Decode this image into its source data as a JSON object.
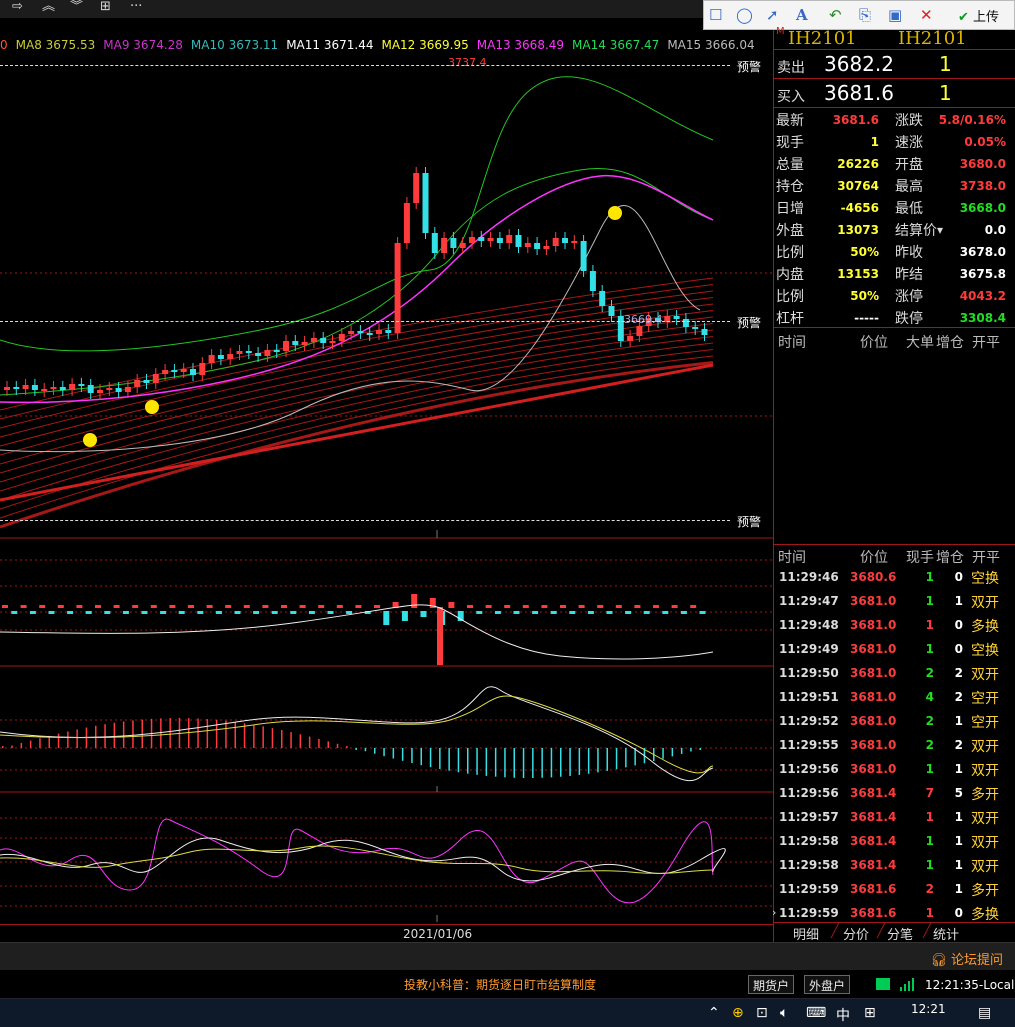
{
  "toolbar": {
    "icons": [
      "redo-icon",
      "double-up-icon",
      "double-down-icon",
      "grid-icon",
      "more-icon"
    ]
  },
  "annotation_tools": {
    "upload_label": "上传"
  },
  "ma_legend": [
    {
      "label": "0",
      "color": "#ff5533"
    },
    {
      "label": "MA8 3675.53",
      "color": "#cccc33"
    },
    {
      "label": "MA9 3674.28",
      "color": "#cc33cc"
    },
    {
      "label": "MA10 3673.11",
      "color": "#33bbbb"
    },
    {
      "label": "MA11 3671.44",
      "color": "#ffffff"
    },
    {
      "label": "MA12 3669.95",
      "color": "#ffff33"
    },
    {
      "label": "MA13 3668.49",
      "color": "#ff33ff"
    },
    {
      "label": "MA14 3667.47",
      "color": "#22dd55"
    },
    {
      "label": "MA15 3666.04",
      "color": "#bbbbbb"
    }
  ],
  "price_annotations": {
    "high": "3737.4",
    "low": "3669.4",
    "alert": "预警"
  },
  "axis": {
    "date": "2021/01/06"
  },
  "contract": {
    "name_left": "IH2101",
    "name_right": "IH2101",
    "marker": "M"
  },
  "order_book": {
    "ask_label": "卖出",
    "ask_price": "3682.2",
    "ask_vol": "1",
    "bid_label": "买入",
    "bid_price": "3681.6",
    "bid_vol": "1"
  },
  "quote": [
    {
      "l": "最新",
      "lv": "3681.6",
      "lc": "#ff3b3b",
      "r": "涨跌",
      "rv": "5.8/0.16%",
      "rc": "#ff3b3b"
    },
    {
      "l": "现手",
      "lv": "1",
      "lc": "#ffff33",
      "r": "速涨",
      "rv": "0.05%",
      "rc": "#ff3b3b"
    },
    {
      "l": "总量",
      "lv": "26226",
      "lc": "#ffff33",
      "r": "开盘",
      "rv": "3680.0",
      "rc": "#ff3b3b"
    },
    {
      "l": "持仓",
      "lv": "30764",
      "lc": "#ffff33",
      "r": "最高",
      "rv": "3738.0",
      "rc": "#ff3b3b"
    },
    {
      "l": "日增",
      "lv": "-4656",
      "lc": "#ffff33",
      "r": "最低",
      "rv": "3668.0",
      "rc": "#22dd22"
    },
    {
      "l": "外盘",
      "lv": "13073",
      "lc": "#ffff33",
      "r": "结算价",
      "rv": "0.0",
      "rc": "#ffffff"
    },
    {
      "l": "比例",
      "lv": "50%",
      "lc": "#ffff33",
      "r": "昨收",
      "rv": "3678.0",
      "rc": "#ffffff"
    },
    {
      "l": "内盘",
      "lv": "13153",
      "lc": "#ffff33",
      "r": "昨结",
      "rv": "3675.8",
      "rc": "#ffffff"
    },
    {
      "l": "比例",
      "lv": "50%",
      "lc": "#ffff33",
      "r": "涨停",
      "rv": "4043.2",
      "rc": "#ff3b3b"
    },
    {
      "l": "杠杆",
      "lv": "-----",
      "lc": "#ffffff",
      "r": "跌停",
      "rv": "3308.4",
      "rc": "#22dd22"
    }
  ],
  "big_order_header": [
    "时间",
    "价位",
    "大单",
    "增仓",
    "开平"
  ],
  "tick_header": [
    "时间",
    "价位",
    "现手",
    "增仓",
    "开平"
  ],
  "ticks": [
    {
      "t": "11:29:46",
      "p": "3680.6",
      "v": "1",
      "vc": "#22dd22",
      "c": "0",
      "k": "空换"
    },
    {
      "t": "11:29:47",
      "p": "3681.0",
      "v": "1",
      "vc": "#22dd22",
      "c": "1",
      "k": "双开"
    },
    {
      "t": "11:29:48",
      "p": "3681.0",
      "v": "1",
      "vc": "#ff3b3b",
      "c": "0",
      "k": "多换"
    },
    {
      "t": "11:29:49",
      "p": "3681.0",
      "v": "1",
      "vc": "#22dd22",
      "c": "0",
      "k": "空换"
    },
    {
      "t": "11:29:50",
      "p": "3681.0",
      "v": "2",
      "vc": "#22dd22",
      "c": "2",
      "k": "双开"
    },
    {
      "t": "11:29:51",
      "p": "3681.0",
      "v": "4",
      "vc": "#22dd22",
      "c": "2",
      "k": "空开"
    },
    {
      "t": "11:29:52",
      "p": "3681.0",
      "v": "2",
      "vc": "#22dd22",
      "c": "1",
      "k": "空开"
    },
    {
      "t": "11:29:55",
      "p": "3681.0",
      "v": "2",
      "vc": "#22dd22",
      "c": "2",
      "k": "双开"
    },
    {
      "t": "11:29:56",
      "p": "3681.0",
      "v": "1",
      "vc": "#22dd22",
      "c": "1",
      "k": "双开"
    },
    {
      "t": "11:29:56",
      "p": "3681.4",
      "v": "7",
      "vc": "#ff3b3b",
      "c": "5",
      "k": "多开"
    },
    {
      "t": "11:29:57",
      "p": "3681.4",
      "v": "1",
      "vc": "#ff3b3b",
      "c": "1",
      "k": "双开"
    },
    {
      "t": "11:29:58",
      "p": "3681.4",
      "v": "1",
      "vc": "#22dd22",
      "c": "1",
      "k": "双开"
    },
    {
      "t": "11:29:58",
      "p": "3681.4",
      "v": "1",
      "vc": "#22dd22",
      "c": "1",
      "k": "双开"
    },
    {
      "t": "11:29:59",
      "p": "3681.6",
      "v": "2",
      "vc": "#ff3b3b",
      "c": "1",
      "k": "多开"
    },
    {
      "t": "11:29:59",
      "p": "3681.6",
      "v": "1",
      "vc": "#ff3b3b",
      "c": "0",
      "k": "多换"
    }
  ],
  "tabs": [
    "明细",
    "分价",
    "分笔",
    "统计"
  ],
  "status": {
    "forum": "论坛提问",
    "news": "投教小科普：期货逐日盯市结算制度",
    "btn_futures": "期货户",
    "btn_outer": "外盘户",
    "clock": "12:21:35-Local"
  },
  "taskbar": {
    "time": "12:21",
    "ime": "中"
  },
  "colors": {
    "up": "#ff3b3b",
    "down": "#33e0e6",
    "grid": "#a0171a"
  }
}
